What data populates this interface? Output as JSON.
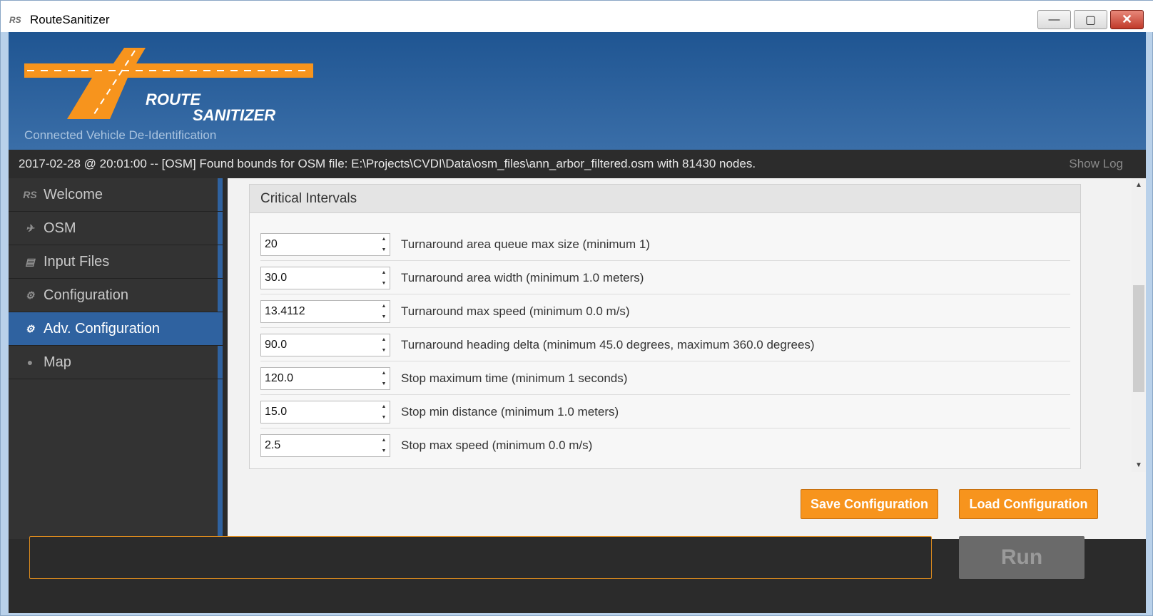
{
  "window": {
    "icon_text": "RS",
    "title": "RouteSanitizer",
    "min_glyph": "—",
    "max_glyph": "▢",
    "close_glyph": "✕"
  },
  "header": {
    "logo_line1": "ROUTE",
    "logo_line2": "SANITIZER",
    "tagline": "Connected Vehicle De-Identification",
    "logo_color": "#f7941d"
  },
  "status": {
    "message": "2017-02-28 @ 20:01:00 -- [OSM] Found bounds for OSM file: E:\\Projects\\CVDI\\Data\\osm_files\\ann_arbor_filtered.osm with 81430 nodes.",
    "show_log": "Show Log"
  },
  "sidebar": {
    "items": [
      {
        "label": "Welcome",
        "icon": "rs-icon",
        "glyph": "RS",
        "active": false
      },
      {
        "label": "OSM",
        "icon": "satellite-icon",
        "glyph": "✈",
        "active": false
      },
      {
        "label": "Input Files",
        "icon": "file-icon",
        "glyph": "▤",
        "active": false
      },
      {
        "label": "Configuration",
        "icon": "gear-icon",
        "glyph": "⚙",
        "active": false
      },
      {
        "label": "Adv. Configuration",
        "icon": "gear-icon",
        "glyph": "⚙",
        "active": true
      },
      {
        "label": "Map",
        "icon": "map-marker-icon",
        "glyph": "●",
        "active": false
      }
    ]
  },
  "panel": {
    "title": "Critical Intervals",
    "rows": [
      {
        "value": "20",
        "label": "Turnaround area queue max size (minimum 1)"
      },
      {
        "value": "30.0",
        "label": "Turnaround area width (minimum 1.0 meters)"
      },
      {
        "value": "13.4112",
        "label": "Turnaround max speed (minimum 0.0 m/s)"
      },
      {
        "value": "90.0",
        "label": "Turnaround heading delta (minimum 45.0 degrees, maximum 360.0 degrees)"
      },
      {
        "value": "120.0",
        "label": "Stop maximum time (minimum 1 seconds)"
      },
      {
        "value": "15.0",
        "label": "Stop min distance (minimum 1.0 meters)"
      },
      {
        "value": "2.5",
        "label": "Stop max speed (minimum 0.0 m/s)"
      }
    ]
  },
  "actions": {
    "save": "Save Configuration",
    "load": "Load Configuration",
    "run": "Run"
  },
  "command": {
    "value": ""
  }
}
